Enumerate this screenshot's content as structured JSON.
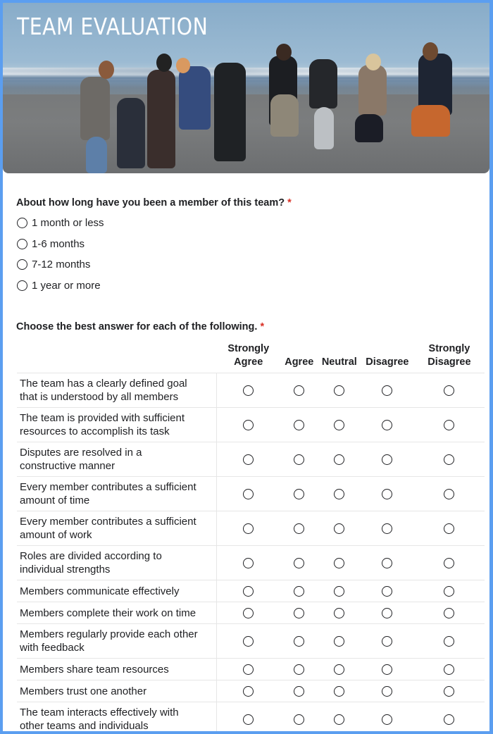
{
  "header": {
    "title": "TEAM EVALUATION",
    "image": "group-jumping-on-beach-photo"
  },
  "question1": {
    "title": "About how long have you been a member of this team?",
    "required_marker": "*",
    "options": [
      "1 month or less",
      "1-6 months",
      "7-12 months",
      "1 year or more"
    ]
  },
  "question2": {
    "title": "Choose the best answer for each of the following.",
    "required_marker": "*",
    "columns": [
      {
        "line1": "Strongly",
        "line2": "Agree"
      },
      {
        "line1": "",
        "line2": "Agree"
      },
      {
        "line1": "",
        "line2": "Neutral"
      },
      {
        "line1": "",
        "line2": "Disagree"
      },
      {
        "line1": "Strongly",
        "line2": "Disagree"
      }
    ],
    "rows": [
      {
        "line1": "The team has a clearly defined goal",
        "line2": "that is understood by all members"
      },
      {
        "line1": "The team is provided with sufficient",
        "line2": "resources to accomplish its task"
      },
      {
        "line1": "Disputes are resolved in a",
        "line2": "constructive manner"
      },
      {
        "line1": "Every member contributes a sufficient",
        "line2": "amount of time"
      },
      {
        "line1": "Every member contributes a sufficient",
        "line2": "amount of work"
      },
      {
        "line1": "Roles are divided according to",
        "line2": "individual strengths"
      },
      {
        "line1": "Members communicate effectively",
        "line2": ""
      },
      {
        "line1": "Members complete their work on time",
        "line2": ""
      },
      {
        "line1": "Members regularly provide each other",
        "line2": "with feedback"
      },
      {
        "line1": "Members share team resources",
        "line2": ""
      },
      {
        "line1": "Members trust one another",
        "line2": ""
      },
      {
        "line1": "The team interacts effectively with",
        "line2": "other teams and individuals"
      }
    ]
  },
  "colors": {
    "frame": "#5b9ef0",
    "required": "#d93025",
    "text": "#202124"
  }
}
